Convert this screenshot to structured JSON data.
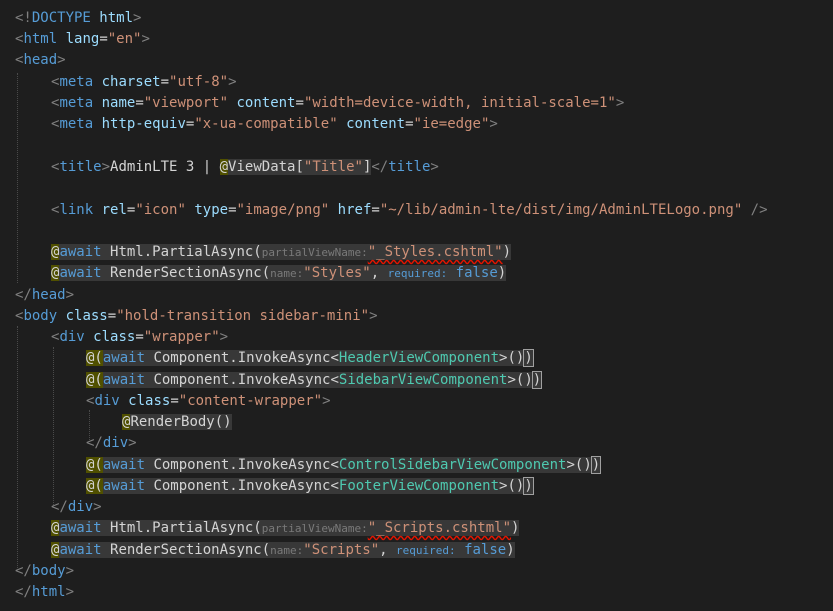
{
  "code": {
    "doctype_open": "<!",
    "doctype_word": "DOCTYPE",
    "doctype_rest": " html",
    "lt": "<",
    "gt": ">",
    "lt_slash": "</",
    "self_close": " />",
    "html_tag": "html",
    "head_tag": "head",
    "body_tag": "body",
    "div_tag": "div",
    "meta_tag": "meta",
    "title_tag": "title",
    "link_tag": "link",
    "attr_lang": "lang",
    "val_en": "\"en\"",
    "attr_charset": "charset",
    "val_utf8": "\"utf-8\"",
    "attr_name": "name",
    "val_viewport": "\"viewport\"",
    "attr_content": "content",
    "val_viewport_content": "\"width=device-width, initial-scale=1\"",
    "attr_http_equiv": "http-equiv",
    "val_xua": "\"x-ua-compatible\"",
    "val_ie_edge": "\"ie=edge\"",
    "title_text": "AdminLTE 3 | ",
    "at": "@",
    "viewdata": "ViewData",
    "bracket_open": "[",
    "bracket_close": "]",
    "val_title": "\"Title\"",
    "attr_rel": "rel",
    "val_icon": "\"icon\"",
    "attr_type": "type",
    "val_image_png": "\"image/png\"",
    "attr_href": "href",
    "val_logo_href": "\"~/lib/admin-lte/dist/img/AdminLTELogo.png\"",
    "kw_await": "await",
    "html_partial": " Html.PartialAsync(",
    "render_section": " RenderSectionAsync(",
    "hint_partial_view_name": "partialViewName:",
    "val_styles_cshtml": "\"_Styles.cshtml\"",
    "val_scripts_cshtml": "\"_Scripts.cshtml\"",
    "close_paren": ")",
    "hint_name": "name:",
    "val_styles": "\"Styles\"",
    "val_scripts": "\"Scripts\"",
    "comma_space": ", ",
    "hint_required": "required:",
    "kw_false": "false",
    "attr_class": "class",
    "val_body_class": "\"hold-transition sidebar-mini\"",
    "val_wrapper": "\"wrapper\"",
    "val_content_wrapper": "\"content-wrapper\"",
    "at_paren": "@(",
    "invoke": " Component.InvokeAsync<",
    "type_header": "HeaderViewComponent",
    "type_sidebar": "SidebarViewComponent",
    "type_control_sidebar": "ControlSidebarViewComponent",
    "type_footer": "FooterViewComponent",
    "invoke_end": ">()",
    "render_body": "RenderBody()",
    "eq": "=",
    "pipe_sep": " | "
  }
}
